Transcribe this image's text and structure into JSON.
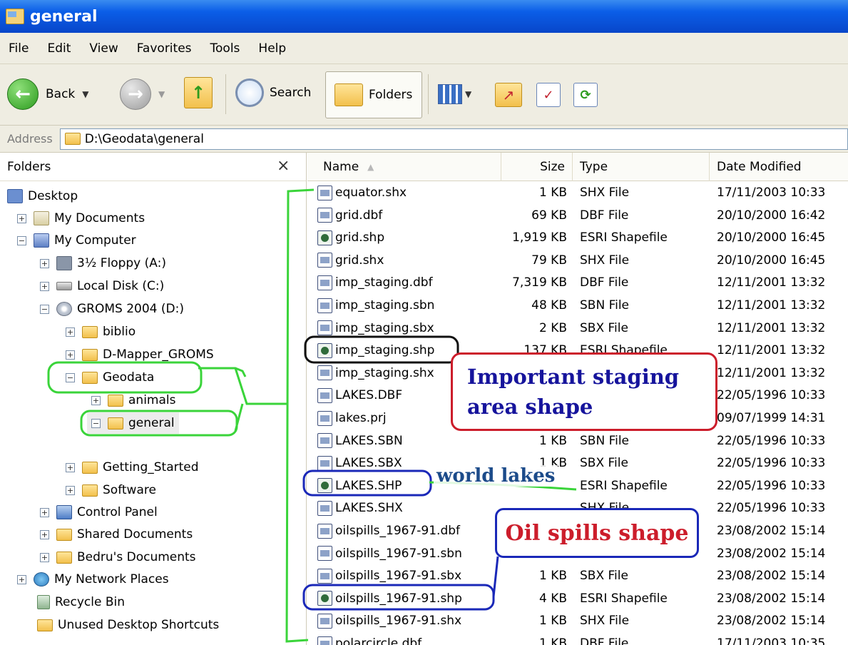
{
  "window": {
    "title": "general"
  },
  "menu": [
    "File",
    "Edit",
    "View",
    "Favorites",
    "Tools",
    "Help"
  ],
  "toolbar": {
    "back": "Back",
    "search": "Search",
    "folders": "Folders"
  },
  "address": {
    "label": "Address",
    "path": "D:\\Geodata\\general"
  },
  "folders_pane": {
    "title": "Folders",
    "close": "×",
    "tree": [
      {
        "label": "Desktop",
        "icon": "desktop-icon",
        "expander": ""
      },
      {
        "label": "My Documents",
        "icon": "my-documents-icon",
        "expander": "+"
      },
      {
        "label": "My Computer",
        "icon": "my-computer-icon",
        "expander": "−"
      },
      {
        "label": "3½ Floppy (A:)",
        "icon": "floppy-icon",
        "expander": "+"
      },
      {
        "label": "Local Disk (C:)",
        "icon": "hard-disk-icon",
        "expander": "+"
      },
      {
        "label": "GROMS 2004 (D:)",
        "icon": "cd-drive-icon",
        "expander": "−"
      },
      {
        "label": "biblio",
        "icon": "folder-icon",
        "expander": "+"
      },
      {
        "label": "D-Mapper_GROMS",
        "icon": "folder-icon",
        "expander": "+"
      },
      {
        "label": "Geodata",
        "icon": "folder-icon",
        "expander": "−"
      },
      {
        "label": "animals",
        "icon": "folder-icon",
        "expander": "+"
      },
      {
        "label": "general",
        "icon": "folder-icon",
        "expander": "−"
      },
      {
        "label": "Getting_Started",
        "icon": "folder-icon",
        "expander": "+"
      },
      {
        "label": "Software",
        "icon": "folder-icon",
        "expander": "+"
      },
      {
        "label": "Control Panel",
        "icon": "control-panel-icon",
        "expander": "+"
      },
      {
        "label": "Shared Documents",
        "icon": "folder-icon",
        "expander": "+"
      },
      {
        "label": "Bedru's Documents",
        "icon": "folder-icon",
        "expander": "+"
      },
      {
        "label": "My Network Places",
        "icon": "network-icon",
        "expander": "+"
      },
      {
        "label": "Recycle Bin",
        "icon": "recycle-bin-icon",
        "expander": ""
      },
      {
        "label": "Unused Desktop Shortcuts",
        "icon": "folder-icon",
        "expander": ""
      }
    ]
  },
  "files": {
    "columns": {
      "name": "Name",
      "size": "Size",
      "type": "Type",
      "date": "Date Modified"
    },
    "sort_indicator": "▲",
    "rows": [
      {
        "name": "equator.shx",
        "size": "1 KB",
        "type": "SHX File",
        "date": "17/11/2003 10:33",
        "icon": "generic-file-icon"
      },
      {
        "name": "grid.dbf",
        "size": "69 KB",
        "type": "DBF File",
        "date": "20/10/2000 16:42",
        "icon": "generic-file-icon"
      },
      {
        "name": "grid.shp",
        "size": "1,919 KB",
        "type": "ESRI Shapefile",
        "date": "20/10/2000 16:45",
        "icon": "shapefile-icon"
      },
      {
        "name": "grid.shx",
        "size": "79 KB",
        "type": "SHX File",
        "date": "20/10/2000 16:45",
        "icon": "generic-file-icon"
      },
      {
        "name": "imp_staging.dbf",
        "size": "7,319 KB",
        "type": "DBF File",
        "date": "12/11/2001 13:32",
        "icon": "generic-file-icon"
      },
      {
        "name": "imp_staging.sbn",
        "size": "48 KB",
        "type": "SBN File",
        "date": "12/11/2001 13:32",
        "icon": "generic-file-icon"
      },
      {
        "name": "imp_staging.sbx",
        "size": "2 KB",
        "type": "SBX File",
        "date": "12/11/2001 13:32",
        "icon": "generic-file-icon"
      },
      {
        "name": "imp_staging.shp",
        "size": "137 KB",
        "type": "ESRI Shapefile",
        "date": "12/11/2001 13:32",
        "icon": "shapefile-icon"
      },
      {
        "name": "imp_staging.shx",
        "size": "",
        "type": "",
        "date": "12/11/2001 13:32",
        "icon": "generic-file-icon"
      },
      {
        "name": "LAKES.DBF",
        "size": "",
        "type": "",
        "date": "22/05/1996 10:33",
        "icon": "generic-file-icon"
      },
      {
        "name": "lakes.prj",
        "size": "",
        "type": "",
        "date": "09/07/1999 14:31",
        "icon": "generic-file-icon"
      },
      {
        "name": "LAKES.SBN",
        "size": "1 KB",
        "type": "SBN File",
        "date": "22/05/1996 10:33",
        "icon": "generic-file-icon"
      },
      {
        "name": "LAKES.SBX",
        "size": "1 KB",
        "type": "SBX File",
        "date": "22/05/1996 10:33",
        "icon": "generic-file-icon"
      },
      {
        "name": "LAKES.SHP",
        "size": "",
        "type": "ESRI Shapefile",
        "date": "22/05/1996 10:33",
        "icon": "shapefile-icon"
      },
      {
        "name": "LAKES.SHX",
        "size": "",
        "type": "SHX File",
        "date": "22/05/1996 10:33",
        "icon": "generic-file-icon"
      },
      {
        "name": "oilspills_1967-91.dbf",
        "size": "",
        "type": "",
        "date": "23/08/2002 15:14",
        "icon": "generic-file-icon"
      },
      {
        "name": "oilspills_1967-91.sbn",
        "size": "",
        "type": "",
        "date": "23/08/2002 15:14",
        "icon": "generic-file-icon"
      },
      {
        "name": "oilspills_1967-91.sbx",
        "size": "1 KB",
        "type": "SBX File",
        "date": "23/08/2002 15:14",
        "icon": "generic-file-icon"
      },
      {
        "name": "oilspills_1967-91.shp",
        "size": "4 KB",
        "type": "ESRI Shapefile",
        "date": "23/08/2002 15:14",
        "icon": "shapefile-icon"
      },
      {
        "name": "oilspills_1967-91.shx",
        "size": "1 KB",
        "type": "SHX File",
        "date": "23/08/2002 15:14",
        "icon": "generic-file-icon"
      },
      {
        "name": "polarcircle.dbf",
        "size": "1 KB",
        "type": "DBF File",
        "date": "17/11/2003 10:35",
        "icon": "generic-file-icon"
      }
    ]
  },
  "annotations": {
    "staging": "Important staging area shape",
    "lakes": "world lakes",
    "oil": "Oil spills shape"
  },
  "colors": {
    "annotation_green": "#3ad43a",
    "annotation_red": "#cc1d2b",
    "annotation_blue": "#1a28b8",
    "annotation_black": "#111111"
  }
}
